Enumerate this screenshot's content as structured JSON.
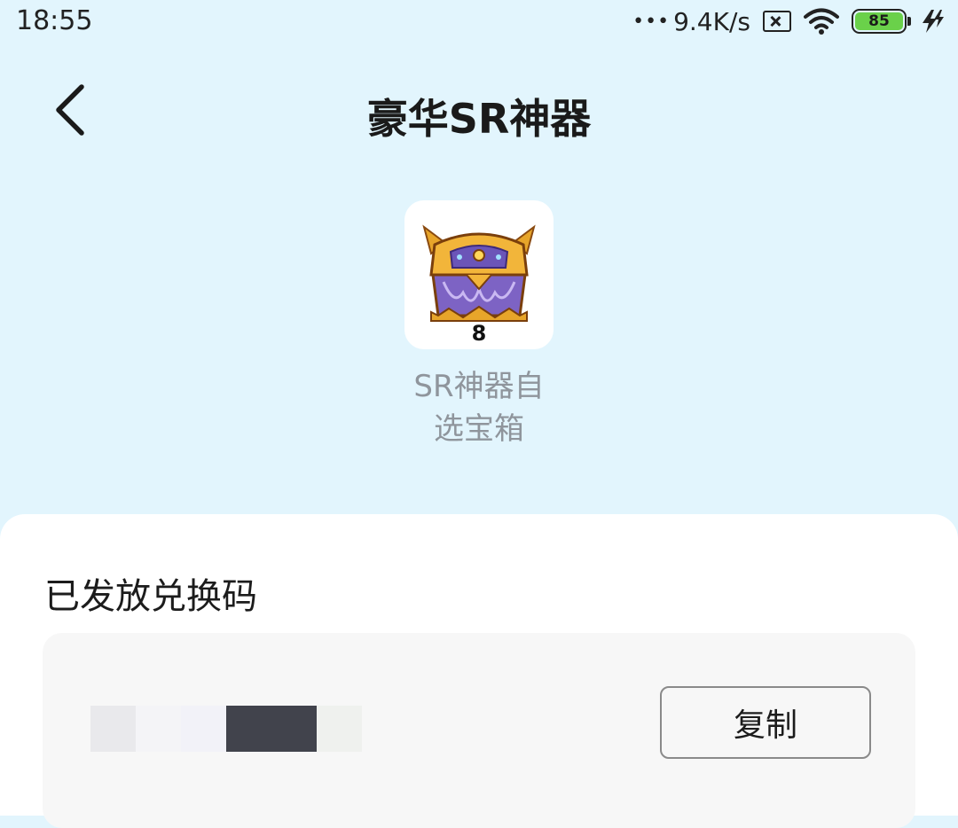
{
  "status_bar": {
    "time": "18:55",
    "dots": "•••",
    "network_speed": "9.4K/s",
    "battery_level": "85",
    "icons": [
      "sim-x-icon",
      "wifi-icon",
      "battery-icon",
      "charging-icon"
    ]
  },
  "header": {
    "title": "豪华SR神器",
    "back_icon": "chevron-left-icon"
  },
  "item": {
    "count": "8",
    "name_line1": "SR神器自",
    "name_line2": "选宝箱",
    "icon": "treasure-chest-icon"
  },
  "codes": {
    "section_title": "已发放兑换码",
    "copy_label": "复制",
    "code_masked_colors": [
      "#e9e9ec",
      "#f4f4f7",
      "#f2f2f8",
      "#41434c",
      "#eff1ee"
    ]
  },
  "colors": {
    "background": "#e2f5fd",
    "card": "#ffffff",
    "code_box": "#f7f7f7"
  }
}
